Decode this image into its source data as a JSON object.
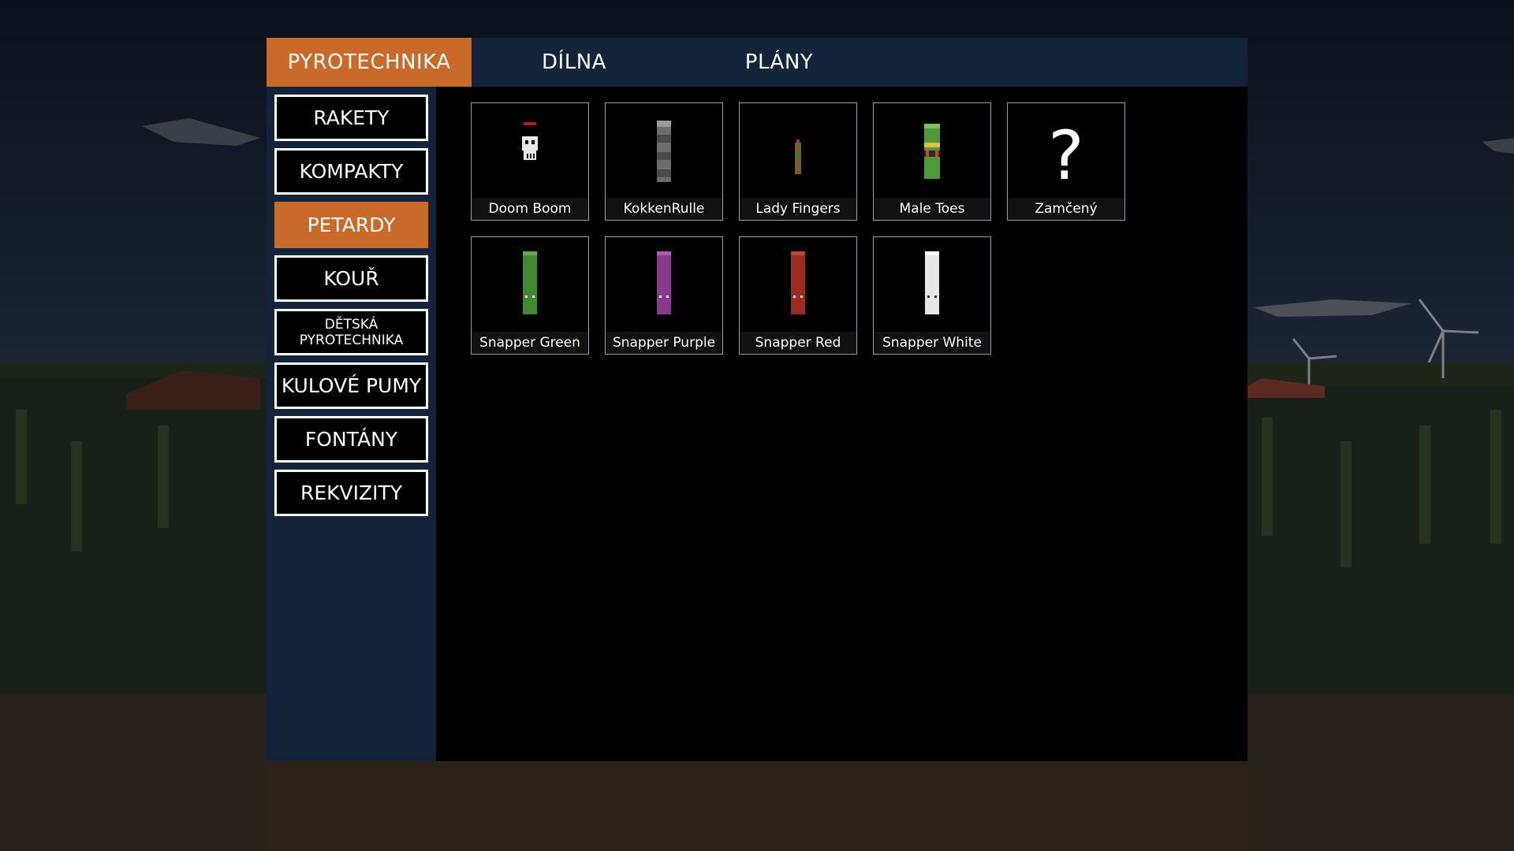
{
  "top_tabs": [
    {
      "label": "PYROTECHNIKA",
      "active": true
    },
    {
      "label": "DÍLNA",
      "active": false
    },
    {
      "label": "PLÁNY",
      "active": false
    }
  ],
  "categories": [
    {
      "label": "RAKETY",
      "active": false
    },
    {
      "label": "KOMPAKTY",
      "active": false
    },
    {
      "label": "PETARDY",
      "active": true
    },
    {
      "label": "KOUŘ",
      "active": false
    },
    {
      "label": "DĚTSKÁ PYROTECHNIKA",
      "line1": "DĚTSKÁ",
      "line2": "PYROTECHNIKA",
      "active": false
    },
    {
      "label": "KULOVÉ PUMY",
      "active": false
    },
    {
      "label": "FONTÁNY",
      "active": false
    },
    {
      "label": "REKVIZITY",
      "active": false
    }
  ],
  "items": [
    {
      "name": "Doom Boom",
      "icon": "skull-firecracker-icon",
      "color": "#ffffff"
    },
    {
      "name": "KokkenRulle",
      "icon": "gray-striped-firecracker-icon",
      "color": "#777777"
    },
    {
      "name": "Lady Fingers",
      "icon": "small-firecracker-icon",
      "color": "#8a6a3a"
    },
    {
      "name": "Male Toes",
      "icon": "green-banded-firecracker-icon",
      "color": "#4e9a3a"
    },
    {
      "name": "Zamčený",
      "icon": "question-mark-icon",
      "color": "#ffffff"
    },
    {
      "name": "Snapper Green",
      "icon": "green-snapper-icon",
      "color": "#3f8a30"
    },
    {
      "name": "Snapper Purple",
      "icon": "purple-snapper-icon",
      "color": "#8a3a8c"
    },
    {
      "name": "Snapper Red",
      "icon": "red-snapper-icon",
      "color": "#9a2a22"
    },
    {
      "name": "Snapper White",
      "icon": "white-snapper-icon",
      "color": "#e6e6e6"
    }
  ],
  "colors": {
    "accent": "#c9692a",
    "panel": "#13233a",
    "content": "#000000"
  }
}
